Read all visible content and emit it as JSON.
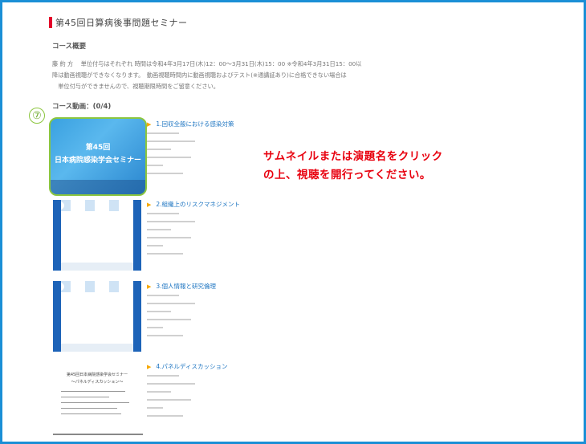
{
  "page": {
    "title": "第45回日算病後事問題セミナー",
    "overview_heading": "コース概要",
    "description_lines": [
      "藤 約 方 　単位付与はそれぞれ 時間は令和4年3月17日(木)12：00～3月31日(木)15：00 ※令和4年3月31日15：00以",
      "降は動画視聴ができなくなります。　動画視聴時間内に動画視聴およびテスト(※通講証あり)に合格できない場合は",
      "　単位付与ができませんので、視聴期限時間をご留意ください。"
    ],
    "videos_heading": "コース動画：(0/4)",
    "step_badge": "⑦"
  },
  "lessons": [
    {
      "title": "1.回収全般における感染対策",
      "thumb_line1": "第45回",
      "thumb_line2": "日本病院感染学会セミナー"
    },
    {
      "title": "2.組織上のリスクマネジメント"
    },
    {
      "title": "3.個人情報と研究倫理"
    },
    {
      "title": "4.パネルディスカッション",
      "thumb_heading": "第45回日本病院感染学会セミナー",
      "thumb_subheading": "～パネルディスカッション～"
    }
  ],
  "notice": {
    "line1": "サムネイルまたは演題名をクリック",
    "line2": "の上、視聴を開行ってください。"
  },
  "colors": {
    "frame": "#1b8fd6",
    "accent_bar": "#e4002b",
    "highlight": "#8cc63f",
    "link": "#1f76c2",
    "notice": "#e8000e"
  }
}
